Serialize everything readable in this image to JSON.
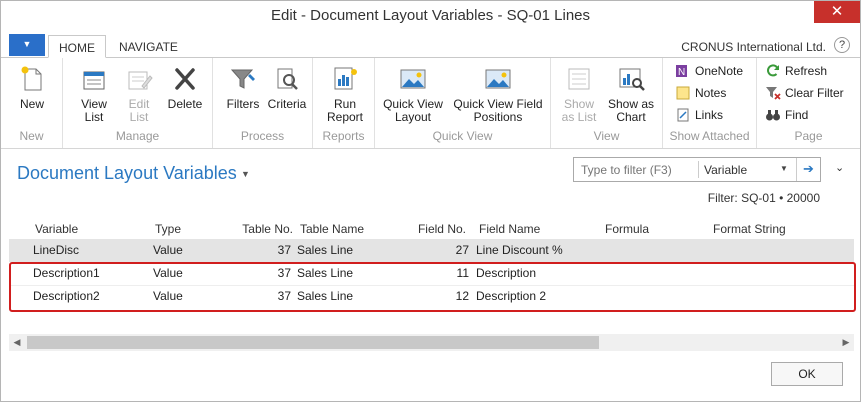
{
  "window": {
    "title": "Edit - Document Layout Variables - SQ-01 Lines",
    "close_glyph": "✕"
  },
  "tabs": {
    "app_menu_glyph": "▼",
    "home": "HOME",
    "navigate": "NAVIGATE",
    "company": "CRONUS International Ltd.",
    "help_glyph": "?"
  },
  "ribbon": {
    "groups": {
      "new": "New",
      "manage": "Manage",
      "process": "Process",
      "reports": "Reports",
      "quick_view": "Quick View",
      "view": "View",
      "show_attached": "Show Attached",
      "page": "Page"
    },
    "buttons": {
      "new": "New",
      "view_list_1": "View",
      "view_list_2": "List",
      "edit_list_1": "Edit",
      "edit_list_2": "List",
      "delete": "Delete",
      "filters": "Filters",
      "criteria": "Criteria",
      "run_report_1": "Run",
      "run_report_2": "Report",
      "qv_layout_1": "Quick View",
      "qv_layout_2": "Layout",
      "qv_fields_1": "Quick View Field",
      "qv_fields_2": "Positions",
      "show_list_1": "Show",
      "show_list_2": "as List",
      "show_chart_1": "Show as",
      "show_chart_2": "Chart",
      "onenote": "OneNote",
      "notes": "Notes",
      "links": "Links",
      "refresh": "Refresh",
      "clear_filter": "Clear Filter",
      "find": "Find"
    }
  },
  "page": {
    "title": "Document Layout Variables",
    "title_caret": "▼",
    "filter_placeholder": "Type to filter (F3)",
    "filter_field": "Variable",
    "filter_dd": "▼",
    "filter_go": "➔",
    "collapse_caret": "⌄",
    "filter_summary": "Filter: SQ-01 • 20000"
  },
  "table": {
    "columns": [
      "Variable",
      "Type",
      "Table No.",
      "Table Name",
      "Field No.",
      "Field Name",
      "Formula",
      "Format String"
    ],
    "rows": [
      {
        "variable": "LineDisc",
        "type": "Value",
        "table_no": "37",
        "table_name": "Sales Line",
        "field_no": "27",
        "field_name": "Line Discount %",
        "formula": "",
        "format": ""
      },
      {
        "variable": "Description1",
        "type": "Value",
        "table_no": "37",
        "table_name": "Sales Line",
        "field_no": "11",
        "field_name": "Description",
        "formula": "",
        "format": ""
      },
      {
        "variable": "Description2",
        "type": "Value",
        "table_no": "37",
        "table_name": "Sales Line",
        "field_no": "12",
        "field_name": "Description 2",
        "formula": "",
        "format": ""
      }
    ]
  },
  "scroll": {
    "left": "◀",
    "right": "▶"
  },
  "footer": {
    "ok": "OK"
  },
  "colors": {
    "accent": "#2b79c2",
    "close": "#c7302b",
    "highlight": "#d11e1e"
  }
}
